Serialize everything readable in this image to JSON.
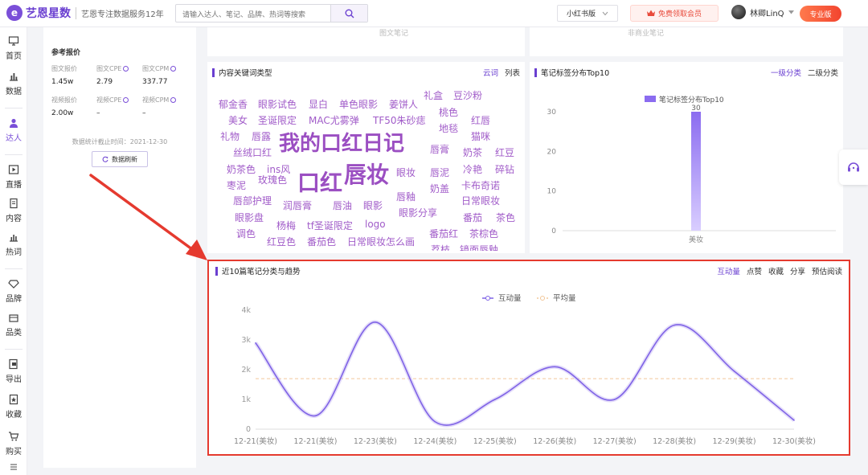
{
  "brand": {
    "logo_mark": "e",
    "name": "艺恩星数",
    "tagline": "艺恩专注数据服务12年"
  },
  "search": {
    "placeholder": "请输入达人、笔记、品牌、热词等搜索"
  },
  "header": {
    "platform": "小红书版",
    "vip_label": "免费领取会员",
    "user_name": "林卿LinQ",
    "pro_label": "专业版"
  },
  "nav": [
    {
      "label": "首页",
      "icon": "monitor-icon"
    },
    {
      "label": "数据",
      "icon": "bar-chart-icon"
    },
    {
      "label": "达人",
      "icon": "person-icon",
      "active": true
    },
    {
      "label": "直播",
      "icon": "play-icon"
    },
    {
      "label": "内容",
      "icon": "document-icon"
    },
    {
      "label": "热词",
      "icon": "trend-icon"
    },
    {
      "label": "品牌",
      "icon": "diamond-icon"
    },
    {
      "label": "品类",
      "icon": "box-icon"
    },
    {
      "label": "导出",
      "icon": "export-icon"
    },
    {
      "label": "收藏",
      "icon": "star-icon"
    },
    {
      "label": "购买",
      "icon": "cart-icon"
    }
  ],
  "profile": {
    "ref_title": "参考报价",
    "metrics": [
      {
        "label": "图文报价",
        "value": "1.45w",
        "info": false
      },
      {
        "label": "图文CPE",
        "value": "2.79",
        "info": true
      },
      {
        "label": "图文CPM",
        "value": "337.77",
        "info": true
      },
      {
        "label": "视频报价",
        "value": "2.00w",
        "info": false
      },
      {
        "label": "视频CPE",
        "value": "–",
        "info": true
      },
      {
        "label": "视频CPM",
        "value": "–",
        "info": true
      }
    ],
    "stat_time": "数据统计截止时间：2021-12-30",
    "refresh_label": "数据刷新"
  },
  "top_fragments": {
    "left": "图文笔记",
    "right": "非商业笔记"
  },
  "keywords_card": {
    "title": "内容关键词类型",
    "tools": [
      "云词",
      "列表"
    ],
    "words": [
      "郁金香",
      "眼影试色",
      "显白",
      "单色眼影",
      "姜饼人",
      "礼盒",
      "豆沙粉",
      "美女",
      "圣诞限定",
      "MAC尤雾弹",
      "TF50朱砂痣",
      "桃色",
      "红唇",
      "地毯",
      "礼物",
      "唇露",
      "我的口红日记",
      "猫咪",
      "丝绒口红",
      "唇膏",
      "奶茶",
      "红豆",
      "奶茶色",
      "ins风",
      "口红",
      "唇妆",
      "眼妆",
      "唇泥",
      "冷艳",
      "碎钻",
      "枣泥",
      "玫瑰色",
      "奶盖",
      "卡布奇诺",
      "唇釉",
      "唇部护理",
      "润唇膏",
      "唇油",
      "眼影",
      "日常眼妆",
      "眼影盘",
      "杨梅",
      "tf圣诞限定",
      "logo",
      "眼影分享",
      "番茄",
      "茶色",
      "调色",
      "红豆色",
      "番茄色",
      "日常眼妆怎么画",
      "番茄红",
      "茶棕色",
      "荔枝",
      "镜面唇釉"
    ]
  },
  "tags_card": {
    "title": "笔记标签分布Top10",
    "tools": [
      "一级分类",
      "二级分类"
    ]
  },
  "trend_card": {
    "title": "近10篇笔记分类与趋势",
    "tools": [
      "互动量",
      "点赞",
      "收藏",
      "分享",
      "预估阅读"
    ]
  },
  "chart_data": [
    {
      "type": "bar",
      "title": "",
      "legend": [
        "笔记标签分布Top10"
      ],
      "categories": [
        "美妆"
      ],
      "series": [
        {
          "name": "笔记标签分布Top10",
          "values": [
            30
          ]
        }
      ],
      "ylim": [
        0,
        30
      ],
      "yticks": [
        "0",
        "10",
        "20",
        "30"
      ],
      "data_labels": [
        "30"
      ],
      "color": "#8b6cf0"
    },
    {
      "type": "line",
      "title": "",
      "legend": [
        "互动量",
        "平均量"
      ],
      "categories": [
        "12-21(美妆)",
        "12-21(美妆)",
        "12-23(美妆)",
        "12-24(美妆)",
        "12-25(美妆)",
        "12-26(美妆)",
        "12-27(美妆)",
        "12-28(美妆)",
        "12-29(美妆)",
        "12-30(美妆)"
      ],
      "series": [
        {
          "name": "互动量",
          "values": [
            2900,
            450,
            3600,
            250,
            1000,
            2100,
            1000,
            3500,
            1950,
            300
          ]
        },
        {
          "name": "平均量",
          "values": [
            1700,
            1700,
            1700,
            1700,
            1700,
            1700,
            1700,
            1700,
            1700,
            1700
          ]
        }
      ],
      "ylim": [
        0,
        4000
      ],
      "yticks": [
        "0",
        "1k",
        "2k",
        "3k",
        "4k"
      ],
      "colors": {
        "line": "#7f63e6",
        "average": "#f2c79a"
      }
    }
  ]
}
